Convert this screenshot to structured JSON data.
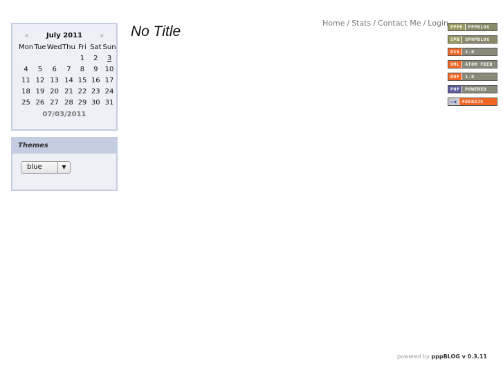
{
  "calendar": {
    "prev": "«",
    "next": "»",
    "month": "July 2011",
    "weekdays": [
      "Mon",
      "Tue",
      "Wed",
      "Thu",
      "Fri",
      "Sat",
      "Sun"
    ],
    "weeks": [
      [
        "",
        "",
        "",
        "",
        "1",
        "2",
        "3"
      ],
      [
        "4",
        "5",
        "6",
        "7",
        "8",
        "9",
        "10"
      ],
      [
        "11",
        "12",
        "13",
        "14",
        "15",
        "16",
        "17"
      ],
      [
        "18",
        "19",
        "20",
        "21",
        "22",
        "23",
        "24"
      ],
      [
        "25",
        "26",
        "27",
        "28",
        "29",
        "30",
        "31"
      ]
    ],
    "today": "3",
    "date_label": "07/03/2011"
  },
  "themes": {
    "title": "Themes",
    "selected": "blue"
  },
  "page": {
    "title": "No Title"
  },
  "nav": {
    "items": [
      "Home",
      "Stats",
      "Contact Me",
      "Login"
    ],
    "separator": "/"
  },
  "badges": [
    {
      "left": "PPPB",
      "right": "PPPBLOG",
      "left_color": "#9a9a60",
      "right_color": "#8a8a6a"
    },
    {
      "left": "SPB",
      "right": "SPHPBLOG",
      "left_color": "#9a9a60",
      "right_color": "#8a8a6a"
    },
    {
      "left": "RSS",
      "right": "2.0",
      "left_color": "#f26522",
      "right_color": "#8a8a7a"
    },
    {
      "left": "XML",
      "right": "ATOM FEED",
      "left_color": "#f26522",
      "right_color": "#8a8a7a"
    },
    {
      "left": "RDF",
      "right": "1.0",
      "left_color": "#f26522",
      "right_color": "#8a8a7a"
    },
    {
      "left": "PHP",
      "right": "POWERED",
      "left_color": "#5a5a9a",
      "right_color": "#8a8a7a"
    },
    {
      "left": "▭◀",
      "right": "FEED2JS",
      "left_color": "#c8c8d0",
      "right_color": "#f26522"
    }
  ],
  "footer": {
    "prefix": "powered by",
    "brand": "pppBLOG v 0.3.11"
  }
}
